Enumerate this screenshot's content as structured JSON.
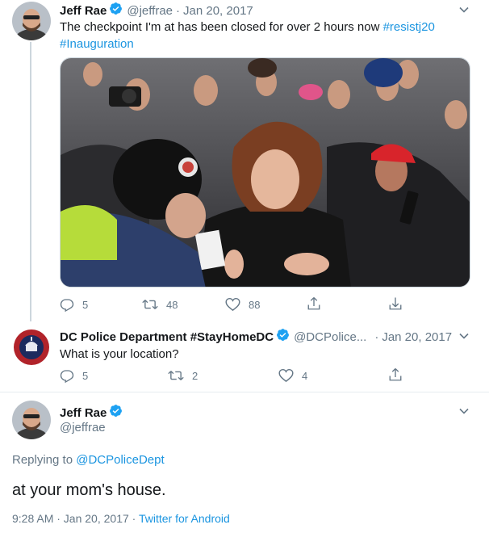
{
  "colors": {
    "link": "#1b95e0",
    "muted": "#657786",
    "verified": "#1da1f2",
    "like": "#657786",
    "border": "#e6ecf0"
  },
  "tweet1": {
    "name": "Jeff Rae",
    "handle": "@jeffrae",
    "sep": "·",
    "date": "Jan 20, 2017",
    "text": "The checkpoint I'm at has been closed for over 2 hours now",
    "hashtag1": "#resistj20",
    "hashtag2": "#Inauguration",
    "replies": "5",
    "retweets": "48",
    "likes": "88"
  },
  "tweet2": {
    "name": "DC Police Department #StayHomeDC",
    "handle": "@DCPolice...",
    "sep": "·",
    "date": "Jan 20, 2017",
    "text": "What is your location?",
    "avatar_text": "METROPOLITAN POLICE",
    "replies": "5",
    "retweets": "2",
    "likes": "4"
  },
  "tweet3": {
    "name": "Jeff Rae",
    "handle": "@jeffrae",
    "replying_prefix": "Replying to",
    "replying_handle": "@DCPoliceDept",
    "text": "at your mom's house.",
    "time": "9:28 AM · Jan 20, 2017",
    "sep": "·",
    "client": "Twitter for Android"
  },
  "icons": [
    "reply-icon",
    "retweet-icon",
    "like-icon",
    "share-icon",
    "download-icon",
    "chevron-down-icon",
    "verified-icon"
  ]
}
